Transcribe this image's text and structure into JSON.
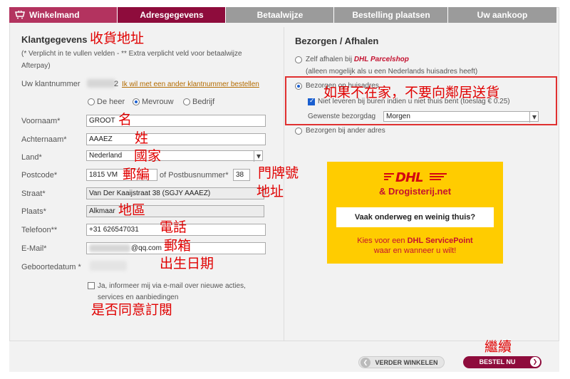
{
  "steps": [
    "Winkelmand",
    "Adresgegevens",
    "Betaalwijze",
    "Bestelling plaatsen",
    "Uw aankoop"
  ],
  "left": {
    "title": "Klantgegevens",
    "note": "(* Verplicht in te vullen velden - ** Extra verplicht veld voor betaalwijze Afterpay)",
    "klantnummer_label": "Uw klantnummer",
    "klantnummer_tail": "2",
    "klantnummer_link": "Ik wil met een ander klantnummer bestellen",
    "salutations": [
      "De heer",
      "Mevrouw",
      "Bedrijf"
    ],
    "labels": {
      "voornaam": "Voornaam*",
      "achternaam": "Achternaam*",
      "land": "Land*",
      "postcode": "Postcode*",
      "postbus": "of Postbusnummer*",
      "straat": "Straat*",
      "plaats": "Plaats*",
      "telefoon": "Telefoon**",
      "email": "E-Mail*",
      "geboortedatum": "Geboortedatum *"
    },
    "values": {
      "voornaam": "GROOT",
      "achternaam": "AAAEZ",
      "land": "Nederland",
      "postcode": "1815 VM",
      "huisnummer": "38",
      "straat": "Van Der Kaaijstraat 38  (SGJY AAAEZ)",
      "plaats": "Alkmaar",
      "telefoon": "+31 626547031",
      "email_suffix": "@qq.com"
    },
    "newsletter": "Ja, informeer mij via e-mail over nieuwe acties, services en aanbiedingen"
  },
  "right": {
    "title": "Bezorgen / Afhalen",
    "opt1_a": "Zelf afhalen bij ",
    "opt1_b": "DHL Parcelshop",
    "opt1_note": "(alleen mogelijk als u een Nederlands huisadres heeft)",
    "opt2": "Bezorgen op huisadres",
    "opt2_check": "Niet leveren bij buren indien u niet thuis bent (toeslag € 0.25)",
    "bezorgdag_label": "Gewenste bezorgdag",
    "bezorgdag_value": "Morgen",
    "opt3": "Bezorgen bij ander adres"
  },
  "banner": {
    "logo": "DHL",
    "sub": "& Drogisterij.net",
    "box": "Vaak onderweg en weinig thuis?",
    "line1a": "Kies voor een ",
    "line1b": "DHL ServicePoint",
    "line2": "waar en wanneer u wilt!"
  },
  "buttons": {
    "back": "VERDER WINKELEN",
    "next": "BESTEL NU"
  },
  "annotations": {
    "title": "收貨地址",
    "voornaam": "名",
    "achternaam": "姓",
    "land": "國家",
    "postcode": "郵編",
    "huisnummer": "門牌號",
    "straat": "地址",
    "plaats": "地區",
    "telefoon": "電話",
    "email": "郵箱",
    "geboortedatum": "出生日期",
    "newsletter": "是否同意訂閱",
    "neighbours": "如果不在家，不要向鄰居送貨",
    "continue": "繼續"
  },
  "colors": {
    "primary": "#8e0c3c",
    "done": "#b3335f",
    "todo": "#9b9b9b",
    "annotation": "#e00000",
    "dhl_yellow": "#ffcc00"
  }
}
